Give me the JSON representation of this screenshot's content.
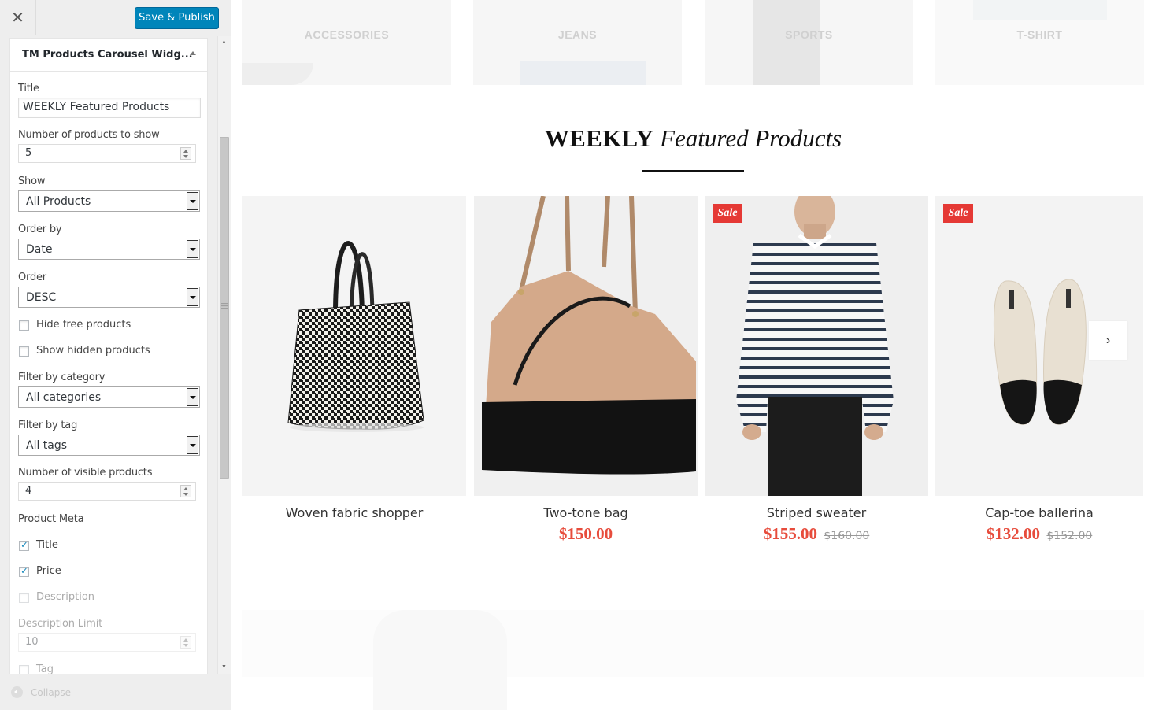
{
  "toolbar": {
    "close_icon": "close-icon",
    "publish_label": "Save & Publish"
  },
  "widget": {
    "title": "TM Products Carousel Widg...",
    "fields": {
      "title_label": "Title",
      "title_value": "WEEKLY Featured Products",
      "num_products_label": "Number of products to show",
      "num_products_value": "5",
      "show_label": "Show",
      "show_value": "All Products",
      "order_by_label": "Order by",
      "order_by_value": "Date",
      "order_label": "Order",
      "order_value": "DESC",
      "hide_free_label": "Hide free products",
      "show_hidden_label": "Show hidden products",
      "filter_cat_label": "Filter by category",
      "filter_cat_value": "All categories",
      "filter_tag_label": "Filter by tag",
      "filter_tag_value": "All tags",
      "visible_products_label": "Number of visible products",
      "visible_products_value": "4",
      "product_meta_label": "Product Meta",
      "meta_title_label": "Title",
      "meta_price_label": "Price",
      "meta_description_label": "Description",
      "desc_limit_label": "Description Limit",
      "desc_limit_value": "10",
      "meta_tag_label": "Tag"
    },
    "checkbox_states": {
      "hide_free": false,
      "show_hidden": false,
      "meta_title": true,
      "meta_price": true,
      "meta_description": false,
      "meta_tag": false
    }
  },
  "collapse_label": "Collapse",
  "preview": {
    "categories": [
      "ACCESSORIES",
      "JEANS",
      "SPORTS",
      "T-SHIRT"
    ],
    "section_title_bold": "WEEKLY",
    "section_title_italic": "Featured Products",
    "products": [
      {
        "name": "Woven fabric shopper",
        "price": "",
        "old_price": "",
        "sale": false
      },
      {
        "name": "Two-tone bag",
        "price": "$150.00",
        "old_price": "",
        "sale": false
      },
      {
        "name": "Striped sweater",
        "price": "$155.00",
        "old_price": "$160.00",
        "sale": true
      },
      {
        "name": "Cap-toe ballerina",
        "price": "$132.00",
        "old_price": "$152.00",
        "sale": true
      }
    ],
    "sale_badge": "Sale",
    "next_icon": "chevron-right-icon"
  },
  "colors": {
    "accent": "#0085ba",
    "price": "#e74c3c",
    "sale_badge": "#e53935"
  }
}
